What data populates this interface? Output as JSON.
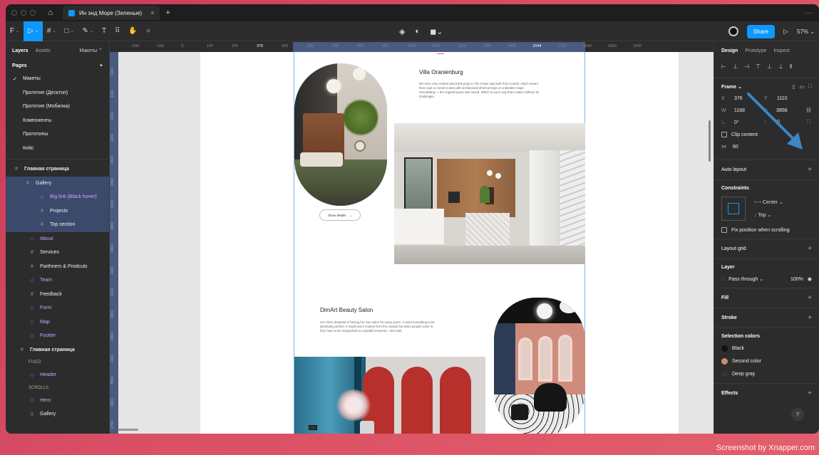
{
  "tabbar": {
    "tab_title": "Ин энд Море (Зеленые)",
    "close": "×",
    "new": "+",
    "more": "···"
  },
  "toolbar": {
    "share": "Share",
    "zoom": "57%",
    "text_tool": "T"
  },
  "left": {
    "tabs": {
      "layers": "Layers",
      "assets": "Assets",
      "pages_dropdown": "Макеты ⌃"
    },
    "pages_title": "Pages",
    "pages": [
      "Макеты",
      "Прототип (Десктоп)",
      "Прототип (Мобилка)",
      "Компоненты",
      "Прототипы",
      "Кейс"
    ],
    "layers": [
      {
        "label": "Главная страница",
        "icon": "#",
        "indent": 0,
        "style": "",
        "name": "layer-main-page-1"
      },
      {
        "label": "Gallery",
        "icon": "#",
        "indent": 16,
        "style": "hl",
        "name": "layer-gallery"
      },
      {
        "label": "Big link (Black hover)",
        "icon": "◇",
        "indent": 36,
        "style": "hl2 purple",
        "name": "layer-big-link"
      },
      {
        "label": "Projects",
        "icon": "#",
        "indent": 36,
        "style": "hl2",
        "name": "layer-projects"
      },
      {
        "label": "Top section",
        "icon": "#",
        "indent": 36,
        "style": "hl2",
        "name": "layer-top-section"
      },
      {
        "label": "About",
        "icon": "◇",
        "indent": 22,
        "style": "purple",
        "name": "layer-about"
      },
      {
        "label": "Services",
        "icon": "#",
        "indent": 22,
        "style": "",
        "name": "layer-services"
      },
      {
        "label": "Parthners & Prodcuts",
        "icon": "#",
        "indent": 22,
        "style": "",
        "name": "layer-partners"
      },
      {
        "label": "Team",
        "icon": "◇",
        "indent": 22,
        "style": "purple",
        "name": "layer-team"
      },
      {
        "label": "Feedback",
        "icon": "#",
        "indent": 22,
        "style": "",
        "name": "layer-feedback"
      },
      {
        "label": "Form",
        "icon": "◇",
        "indent": 22,
        "style": "purple",
        "name": "layer-form"
      },
      {
        "label": "Map",
        "icon": "◇",
        "indent": 22,
        "style": "purple",
        "name": "layer-map"
      },
      {
        "label": "Footter",
        "icon": "◇",
        "indent": 22,
        "style": "purple",
        "name": "layer-footer"
      },
      {
        "label": "Главная страница",
        "icon": "#",
        "indent": 8,
        "style": "",
        "name": "layer-main-page-2"
      },
      {
        "label": "FIXED",
        "icon": "",
        "indent": 22,
        "style": "cap",
        "name": "layer-caption-fixed"
      },
      {
        "label": "Header",
        "icon": "◇",
        "indent": 22,
        "style": "purple",
        "name": "layer-header"
      },
      {
        "label": "SCROLLS",
        "icon": "",
        "indent": 22,
        "style": "cap",
        "name": "layer-caption-scrolls"
      },
      {
        "label": "Hero",
        "icon": "◇",
        "indent": 22,
        "style": "purple",
        "name": "layer-hero"
      },
      {
        "label": "Gallery",
        "icon": "⠿",
        "indent": 22,
        "style": "",
        "name": "layer-gallery-2"
      }
    ]
  },
  "ruler": {
    "ticks": [
      "-200",
      "-100",
      "0",
      "100",
      "200",
      "376",
      "500",
      "600",
      "700",
      "800",
      "900",
      "1000",
      "1100",
      "1200",
      "1300",
      "1400",
      "1544",
      "1700",
      "1800",
      "1900",
      "2000"
    ],
    "vticks": [
      "1100",
      "1200",
      "1300",
      "1400",
      "1500",
      "1600",
      "1700",
      "1800",
      "1900",
      "2000",
      "2100",
      "2200",
      "2300",
      "2400",
      "2500",
      "2600",
      "2700"
    ]
  },
  "canvas": {
    "villa_title": "Villa Oranienburg",
    "villa_text": "We were very excited about this project. The house was built from scratch, which meant there was no need to deal with architectural shortcomings or undertake major remodelling — the original layout was sound. Which is not to say that it wasn't without its challenges.",
    "show_details": "Show details",
    "dimart_title": "DimArt Beauty Salon",
    "dimart_text": "Our client dreamed of having her own salon for many years. «I want everything to be absolutely perfect. It might seem modest from the outside but when people come in, they have to be transported to a parallel universe,» she said."
  },
  "right": {
    "tabs": {
      "design": "Design",
      "prototype": "Prototype",
      "inspect": "Inspect"
    },
    "frame_label": "Frame ⌄",
    "x": "376",
    "y": "1110",
    "w": "1168",
    "h": "3856",
    "rotation": "0°",
    "radius": "0",
    "clip_content": "Clip content",
    "spacing": "60",
    "auto_layout": "Auto layout",
    "constraints": "Constraints",
    "constraint_h": "Center ⌄",
    "constraint_v": "Top ⌄",
    "fix_position": "Fix position when scrolling",
    "layout_grid": "Layout grid",
    "layer_title": "Layer",
    "blend": "Pass through ⌄",
    "opacity": "100%",
    "fill": "Fill",
    "stroke": "Stroke",
    "selection_colors": "Selection colors",
    "colors": [
      {
        "name": "Black",
        "hex": "#111111"
      },
      {
        "name": "Second color",
        "hex": "#c8906a"
      },
      {
        "name": "Deep gray",
        "hex": "#333333"
      }
    ],
    "effects": "Effects",
    "help": "?"
  },
  "watermark": "Screenshot by Xnapper.com"
}
